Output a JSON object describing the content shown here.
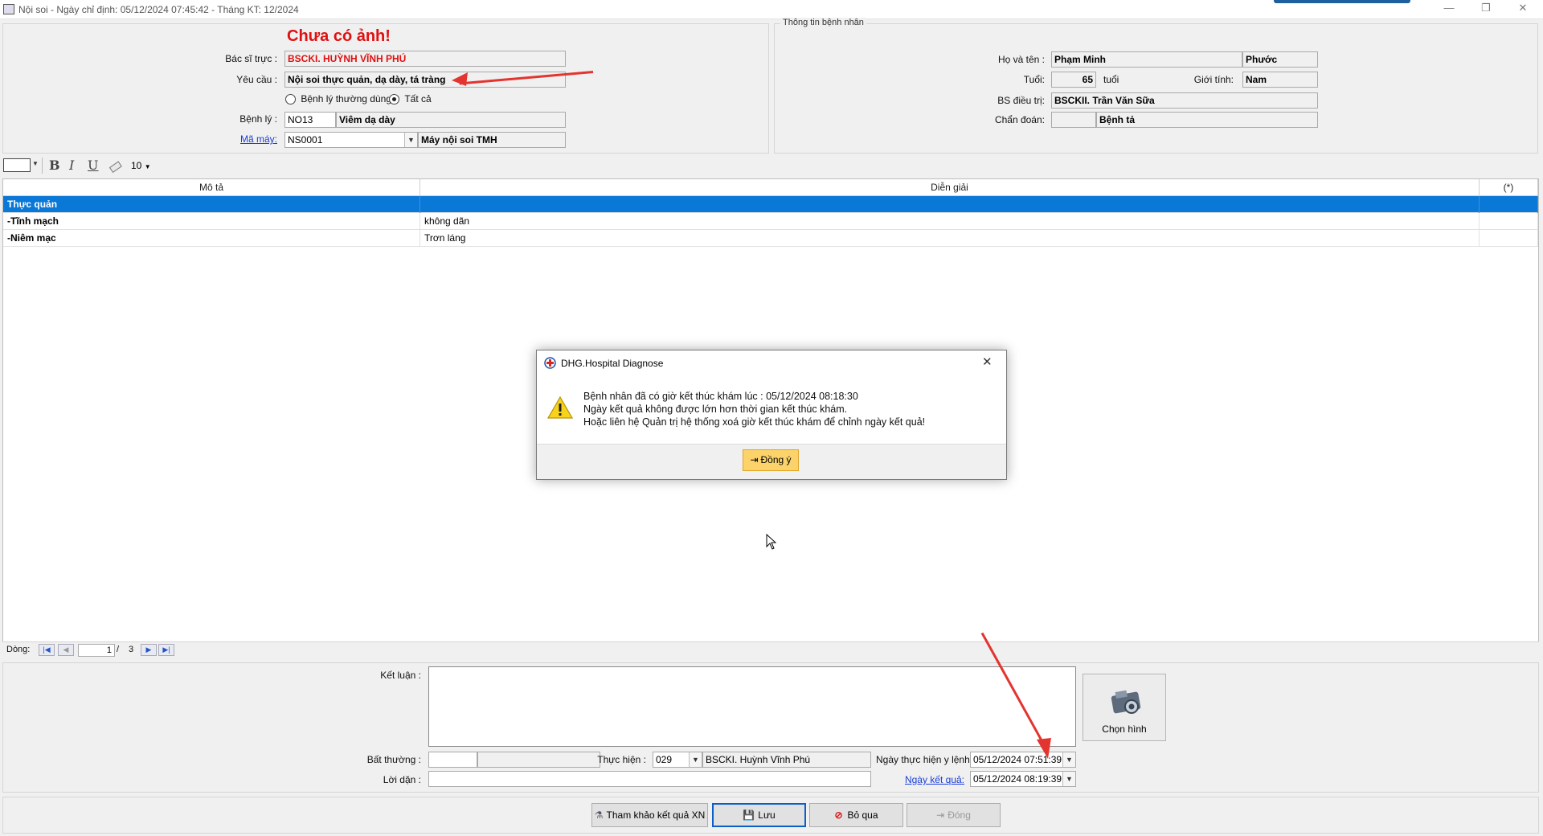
{
  "window": {
    "title": "Nội soi - Ngày chỉ định: 05/12/2024 07:45:42 - Tháng KT: 12/2024",
    "minimize": "—",
    "restore": "❐",
    "close": "✕"
  },
  "request": {
    "no_image": "Chưa có ảnh!",
    "doctor_label": "Bác sĩ trực :",
    "doctor_value": "BSCKI. HUỲNH VĨNH PHÚ",
    "request_label": "Yêu cầu :",
    "request_value": "Nội soi thực quản, dạ dày, tá tràng",
    "radio_common": "Bệnh lý thường dùng",
    "radio_all": "Tất cả",
    "disease_label": "Bệnh lý :",
    "disease_code": "NO13",
    "disease_name": "Viêm dạ dày",
    "machine_label": "Mã máy:",
    "machine_code": "NS0001",
    "machine_name": "Máy nội soi TMH"
  },
  "patient": {
    "legend": "Thông tin bệnh nhân",
    "name_label": "Họ và tên :",
    "last_name": "Phạm Minh",
    "first_name": "Phước",
    "age_label": "Tuổi:",
    "age": "65",
    "age_unit": "tuổi",
    "gender_label": "Giới tính:",
    "gender": "Nam",
    "doctor_label": "BS điều trị:",
    "doctor": "BSCKII. Trần Văn Sữa",
    "diagnosis_label": "Chẩn đoán:",
    "diagnosis": "Bệnh tả"
  },
  "toolbar": {
    "bold": "B",
    "italic": "I",
    "underline": "U",
    "font_size": "10"
  },
  "grid": {
    "columns": [
      "Mô tả",
      "Diễn giải",
      "(*)"
    ],
    "rows": [
      {
        "desc": "Thực quản",
        "detail": "",
        "flag": ""
      },
      {
        "desc": "-Tĩnh mạch",
        "detail": "không dãn",
        "flag": ""
      },
      {
        "desc": "-Niêm mạc",
        "detail": "Trơn láng",
        "flag": ""
      }
    ]
  },
  "pager": {
    "label": "Dòng:",
    "current": "1",
    "separator": "/",
    "total": "3"
  },
  "conclusion": {
    "conclusion_label": "Kết luận :",
    "abnormal_label": "Bất thường :",
    "performer_label": "Thực hiện :",
    "performer_code": "029",
    "performer_name": "BSCKI. Huỳnh Vĩnh Phú",
    "advice_label": "Lời dặn :",
    "exec_date_label": "Ngày thực hiện y lệnh:",
    "exec_date": "05/12/2024 07:51:39",
    "result_date_label": "Ngày kết quả:",
    "result_date": "05/12/2024 08:19:39",
    "choose_image": "Chọn hình"
  },
  "buttons": {
    "reference": "Tham khảo kết quả XN",
    "save": "Lưu",
    "skip": "Bỏ qua",
    "close": "Đóng"
  },
  "dialog": {
    "title": "DHG.Hospital Diagnose",
    "line1": "Bệnh nhân đã có giờ kết thúc khám lúc : 05/12/2024 08:18:30",
    "line2": "Ngày kết quả không được lớn hơn thời gian kết thúc khám.",
    "line3": "Hoặc liên hệ Quản trị hệ thống xoá giờ kết thúc khám để chỉnh ngày kết quả!",
    "ok": "Đồng ý"
  },
  "colors": {
    "selection": "#0a78d7",
    "alert_red": "#e01010",
    "ok_button": "#fbd36a"
  }
}
